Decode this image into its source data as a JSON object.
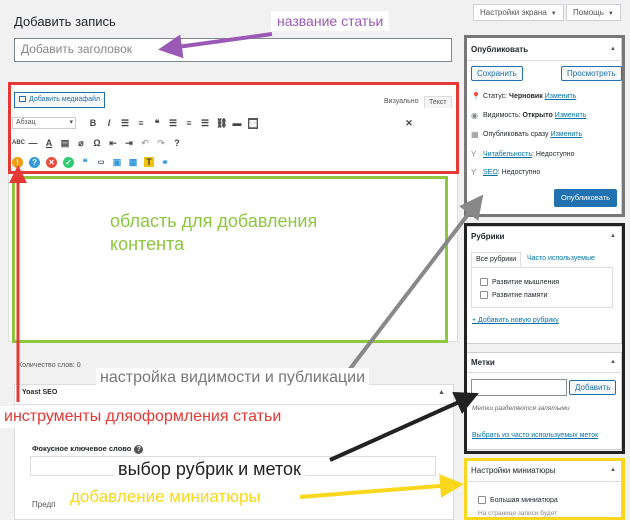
{
  "top_buttons": {
    "screen_options": "Настройки экрана",
    "help": "Помощь"
  },
  "page_title": "Добавить запись",
  "title_input": {
    "placeholder": "Добавить заголовок"
  },
  "editor": {
    "media_button": "Добавить медиафайл",
    "tab_visual": "Визуально",
    "tab_text": "Текст",
    "format_select": "Абзац",
    "word_count": "Количество слов: 0"
  },
  "yoast": {
    "title": "Yoast SEO",
    "focus_keyword_label": "Фокусное ключевое слово",
    "preview_label": "Предп"
  },
  "publish": {
    "title": "Опубликовать",
    "save_button": "Сохранить",
    "preview_button": "Просмотреть",
    "status_label": "Статус:",
    "status_value": "Черновик",
    "visibility_label": "Видимость:",
    "visibility_value": "Открыто",
    "publish_when": "Опубликовать сразу",
    "change_link": "Изменить",
    "readability_label": "Читабельность",
    "readability_value": ": Недоступно",
    "seo_label": "SEO",
    "seo_value": ": Недоступно",
    "publish_button": "Опубликовать"
  },
  "categories": {
    "title": "Рубрики",
    "tab_all": "Все рубрики",
    "tab_popular": "Часто используемые",
    "items": [
      "Развитие мышления",
      "Развитие памяти"
    ],
    "add_link": "+ Добавить новую рубрику"
  },
  "tags": {
    "title": "Метки",
    "add_button": "Добавить",
    "hint": "Метки разделяются запятыми",
    "choose_link": "Выбрать из часто используемых меток"
  },
  "thumbnail": {
    "title": "Настройки миниатюры",
    "checkbox": "Большая миниатюра",
    "hint": "На странице записи будет"
  },
  "annotations": {
    "article_title": "название статьи",
    "content_area": "область для добавления\nконтента",
    "visibility": "настройка видимости и публикации",
    "tools": "инструменты дляоформления статьи",
    "categories_tags": "выбор рубрик и меток",
    "thumbnail": "добавление миниатюры"
  },
  "colors": {
    "annotation_purple": "#9b59b6",
    "annotation_red": "#e53935",
    "annotation_green": "#8dc63f",
    "annotation_grey": "#888888",
    "annotation_black": "#222222",
    "annotation_yellow": "#f9d71c",
    "wp_blue": "#2271b1"
  }
}
